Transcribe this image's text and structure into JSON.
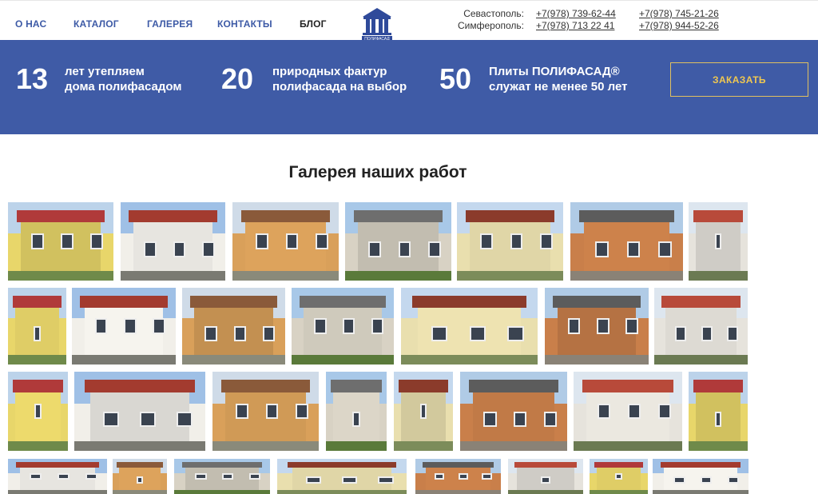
{
  "nav": {
    "items": [
      {
        "label": "О НАС",
        "name": "nav-about"
      },
      {
        "label": "КАТАЛОГ",
        "name": "nav-catalog"
      },
      {
        "label": "ГАЛЕРЕЯ",
        "name": "nav-gallery"
      },
      {
        "label": "КОНТАКТЫ",
        "name": "nav-contacts"
      },
      {
        "label": "БЛОГ",
        "name": "nav-blog"
      }
    ]
  },
  "logo": {
    "text": "ПОЛИФАСАД"
  },
  "contacts": {
    "sevastopol": {
      "city": "Севастополь:",
      "phone1": "+7(978) 739-62-44",
      "phone2": "+7(978) 745-21-26"
    },
    "simferopol": {
      "city": "Симферополь:",
      "phone1": "+7(978) 713 22 41",
      "phone2": "+7(978) 944-52-26"
    }
  },
  "banner": {
    "stats": [
      {
        "number": "13",
        "line1": "лет утепляем",
        "line2": "дома полифасадом"
      },
      {
        "number": "20",
        "line1": "природных фактур",
        "line2": "полифасада на выбор"
      },
      {
        "number": "50",
        "line1": "Плиты ПОЛИФАСАД®",
        "line2": "служат не менее 50 лет"
      }
    ],
    "order_label": "ЗАКАЗАТЬ"
  },
  "gallery": {
    "title": "Галерея наших работ",
    "photo_count": 34
  },
  "colors": {
    "accent_blue": "#3f5ba6",
    "nav_blue": "#3d5aa6",
    "button_gold": "#f0c850"
  }
}
